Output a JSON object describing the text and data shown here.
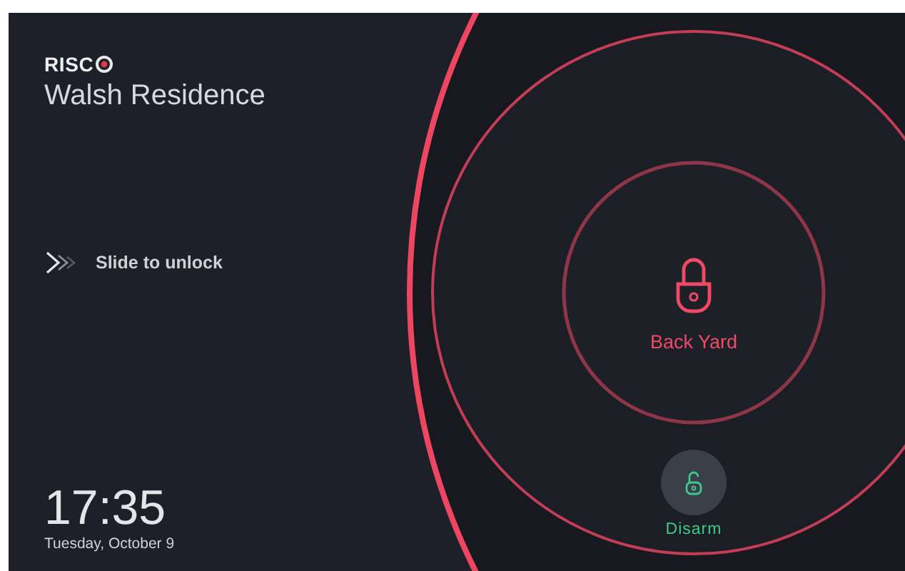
{
  "brand": {
    "logo": "RISC"
  },
  "site": {
    "title": "Walsh Residence"
  },
  "slider": {
    "label": "Slide to unlock"
  },
  "clock": {
    "time": "17:35",
    "date": "Tuesday, October 9"
  },
  "zone": {
    "name": "Back Yard",
    "armed": true
  },
  "action": {
    "label": "Disarm"
  }
}
